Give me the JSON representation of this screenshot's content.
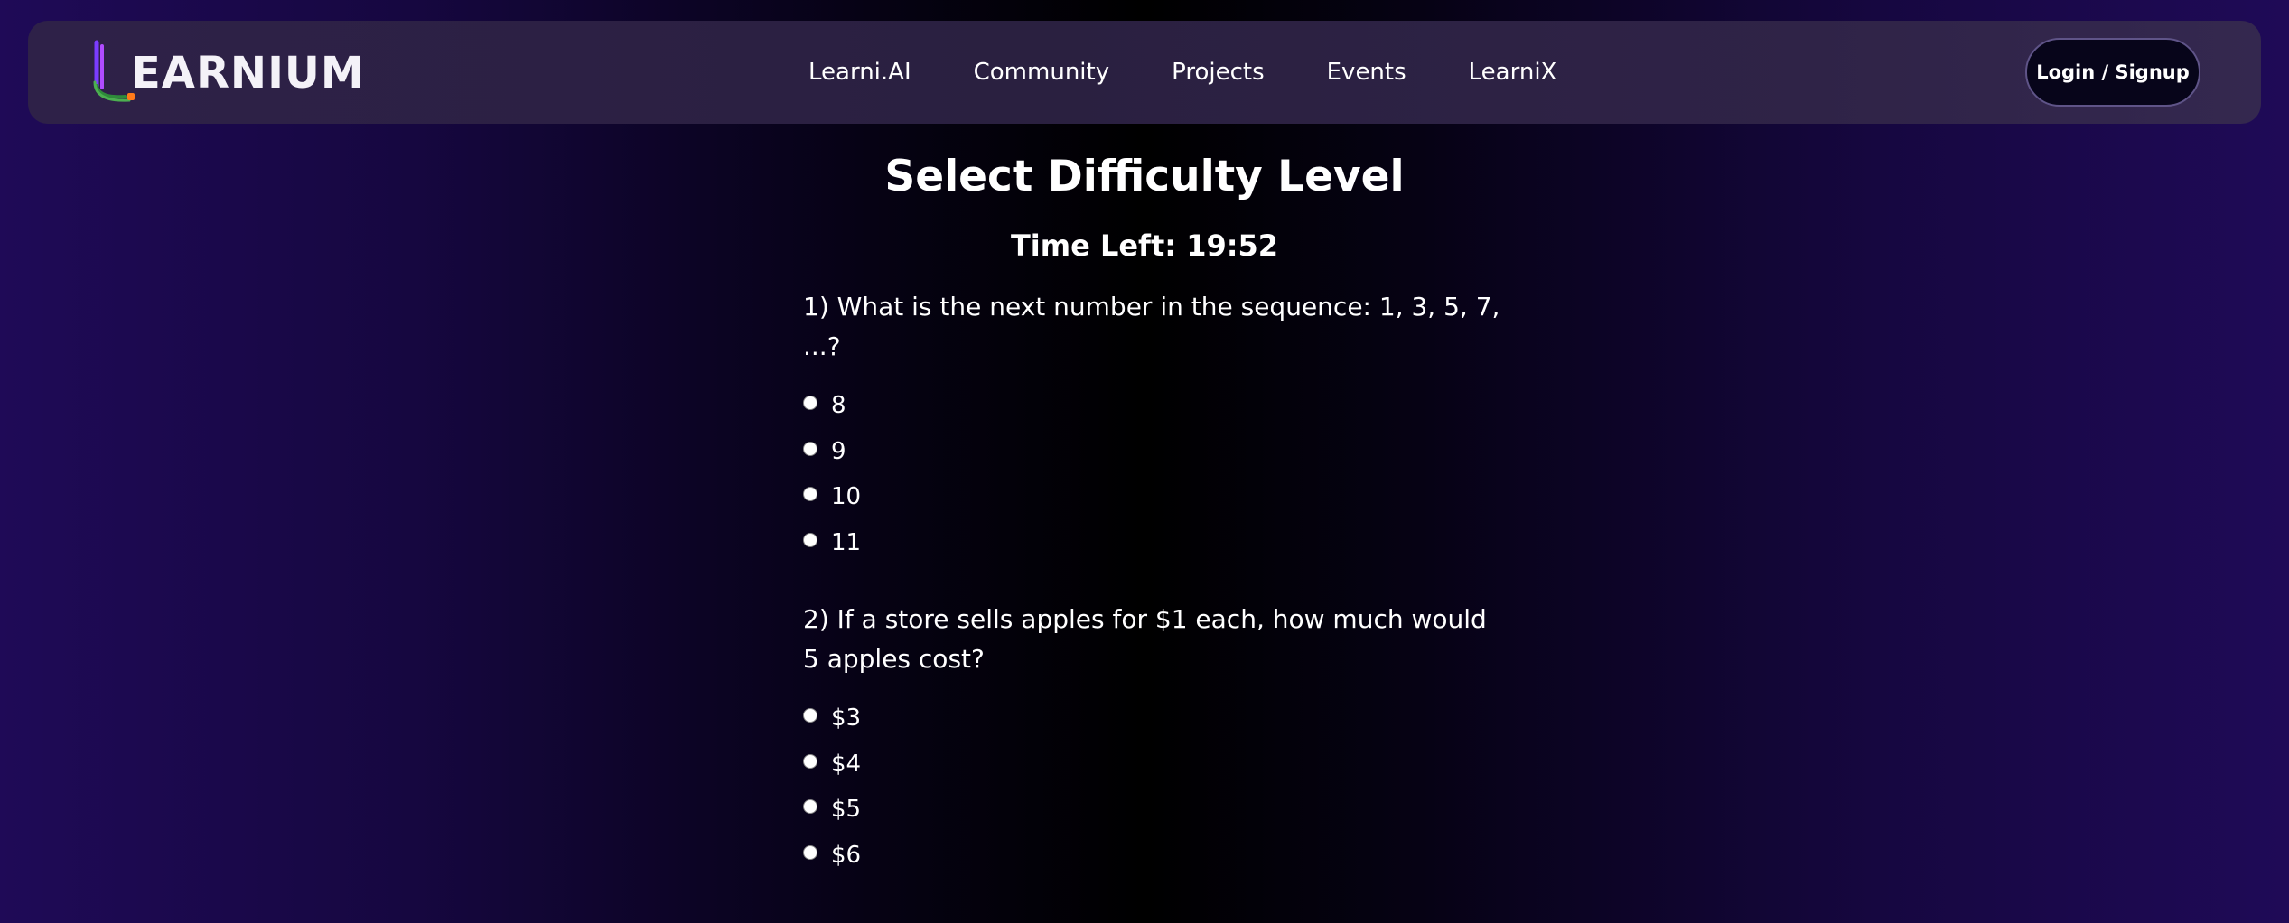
{
  "header": {
    "logo_text": "EARNIUM",
    "nav": [
      {
        "label": "Learni.AI"
      },
      {
        "label": "Community"
      },
      {
        "label": "Projects"
      },
      {
        "label": "Events"
      },
      {
        "label": "LearniX"
      }
    ],
    "login_label": "Login / Signup"
  },
  "main": {
    "title": "Select Difficulty Level",
    "timer": "Time Left: 19:52",
    "questions": [
      {
        "text": "1) What is the next number in the sequence: 1, 3, 5, 7, ...?",
        "options": [
          "8",
          "9",
          "10",
          "11"
        ]
      },
      {
        "text": "2) If a store sells apples for $1 each, how much would 5 apples cost?",
        "options": [
          "$3",
          "$4",
          "$5",
          "$6"
        ]
      }
    ]
  },
  "colors": {
    "background_edge": "#1f0a57",
    "background_center": "#000000",
    "navbar": "#2e2148",
    "login_button": "#07051a",
    "text": "#ffffff"
  },
  "icons": {
    "logo": "learnium-logo-icon"
  }
}
